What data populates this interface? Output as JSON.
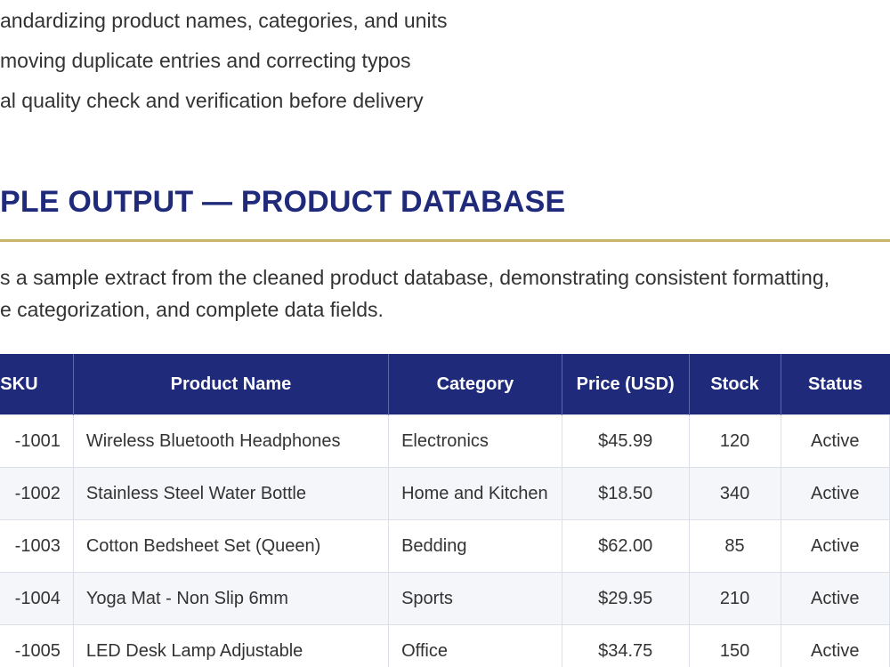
{
  "bullets": [
    "andardizing product names, categories, and units",
    "moving duplicate entries and correcting typos",
    "al quality check and verification before delivery"
  ],
  "section": {
    "heading": "PLE OUTPUT — PRODUCT DATABASE",
    "intro": [
      "s a sample extract from the cleaned product database, demonstrating consistent formatting,",
      "e categorization, and complete data fields."
    ]
  },
  "table": {
    "headers": [
      "SKU",
      "Product Name",
      "Category",
      "Price (USD)",
      "Stock",
      "Status"
    ],
    "rows": [
      {
        "sku": "-1001",
        "name": "Wireless Bluetooth Headphones",
        "category": "Electronics",
        "price": "$45.99",
        "stock": "120",
        "status": "Active"
      },
      {
        "sku": "-1002",
        "name": "Stainless Steel Water Bottle",
        "category": "Home and Kitchen",
        "price": "$18.50",
        "stock": "340",
        "status": "Active"
      },
      {
        "sku": "-1003",
        "name": "Cotton Bedsheet Set (Queen)",
        "category": "Bedding",
        "price": "$62.00",
        "stock": "85",
        "status": "Active"
      },
      {
        "sku": "-1004",
        "name": "Yoga Mat - Non Slip 6mm",
        "category": "Sports",
        "price": "$29.95",
        "stock": "210",
        "status": "Active"
      },
      {
        "sku": "-1005",
        "name": "LED Desk Lamp Adjustable",
        "category": "Office",
        "price": "$34.75",
        "stock": "150",
        "status": "Active"
      }
    ]
  },
  "colors": {
    "heading": "#1f2a7a",
    "table_header_bg": "#1f2a7a",
    "rule": "#c9b46a",
    "zebra": "#f5f6fa"
  }
}
